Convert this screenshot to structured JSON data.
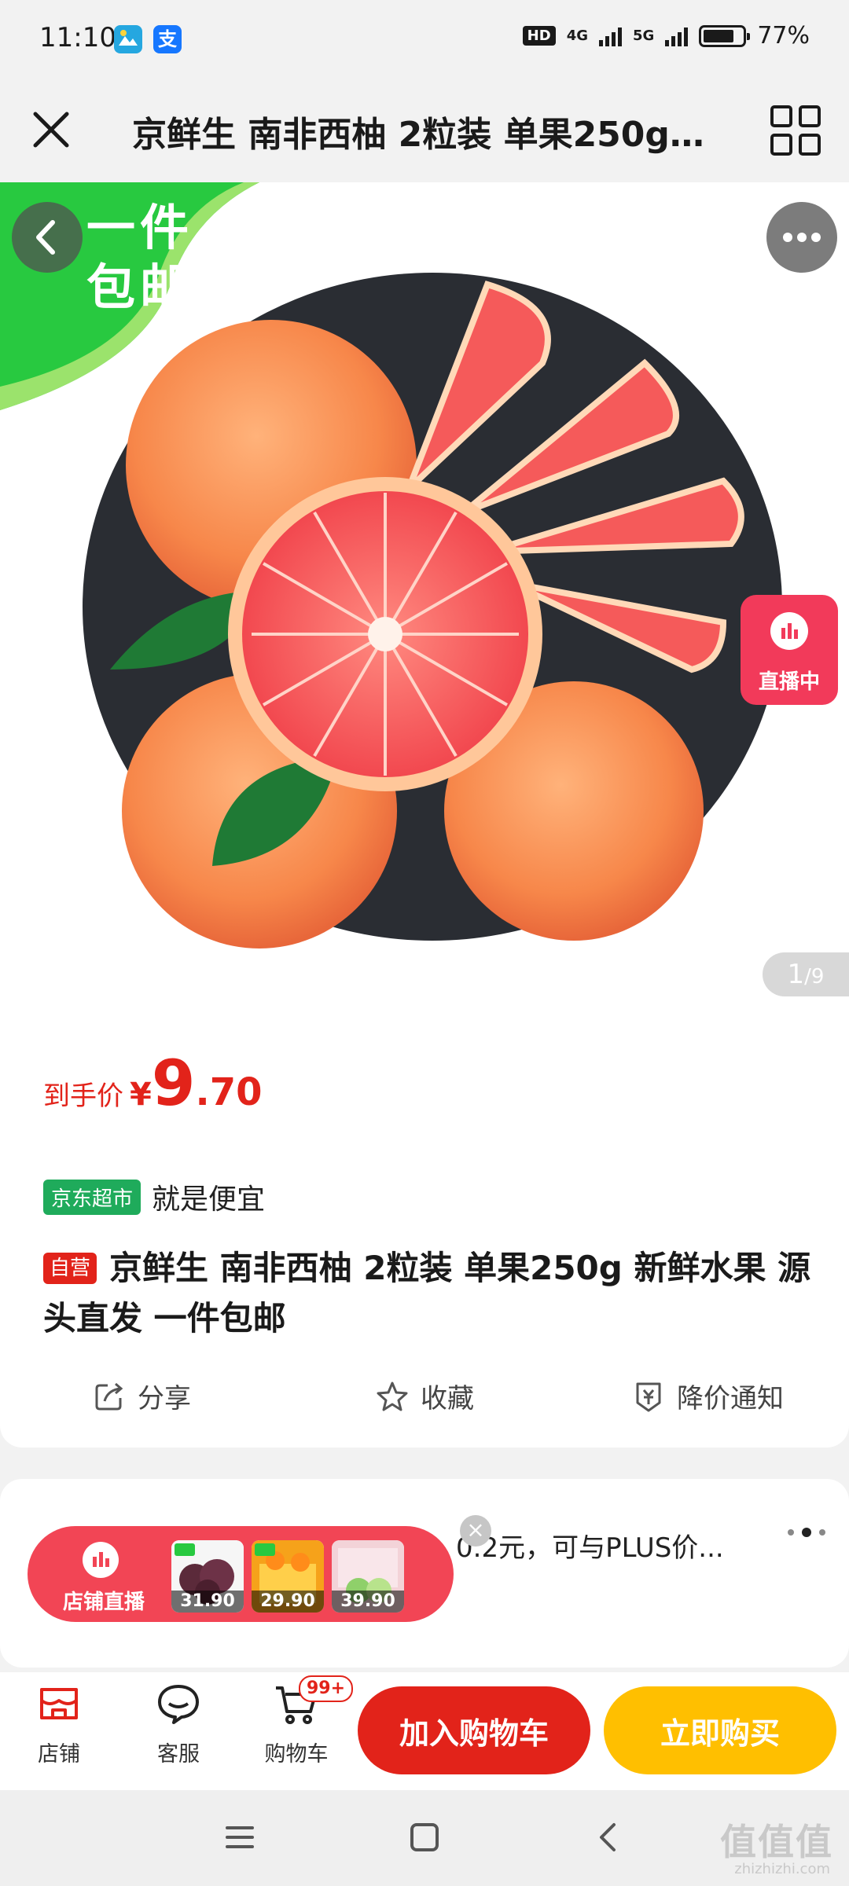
{
  "status_bar": {
    "time": "11:10",
    "app_icon_2": "支",
    "hd": "HD",
    "net_1": "4G",
    "net_2": "5G",
    "battery": "77%"
  },
  "header": {
    "title": "京鲜生 南非西柚 2粒装 单果250g 新鲜水果 源头直发 一件包邮"
  },
  "hero": {
    "promo_badge": "一件包邮",
    "live_label": "直播中",
    "counter_current": "1",
    "counter_total": "/9"
  },
  "price": {
    "label": "到手价",
    "currency": "¥",
    "integer": "9",
    "decimal": ".70"
  },
  "store": {
    "tag": "京东超市",
    "slogan": "就是便宜"
  },
  "product": {
    "self_tag": "自营",
    "title": "京鲜生 南非西柚 2粒装 单果250g 新鲜水果 源头直发 一件包邮"
  },
  "actions": {
    "share": "分享",
    "favorite": "收藏",
    "price_alert": "降价通知"
  },
  "promo_card": {
    "text": "0.2元，可与PLUS价..."
  },
  "store_live": {
    "label": "店铺直播",
    "products": [
      {
        "price": "31.90"
      },
      {
        "price": "29.90"
      },
      {
        "price": "39.90"
      }
    ],
    "close": "×"
  },
  "bottom_bar": {
    "shop": "店铺",
    "service": "客服",
    "cart": "购物车",
    "cart_badge": "99+",
    "add_to_cart": "加入购物车",
    "buy_now": "立即购买"
  },
  "watermark": {
    "text": "值值值",
    "sub": "zhizhizhi.com"
  },
  "colors": {
    "brand_red": "#e2231a",
    "buy_yellow": "#ffbf00",
    "store_green": "#1fab5b",
    "live_pink": "#f23a5a"
  }
}
